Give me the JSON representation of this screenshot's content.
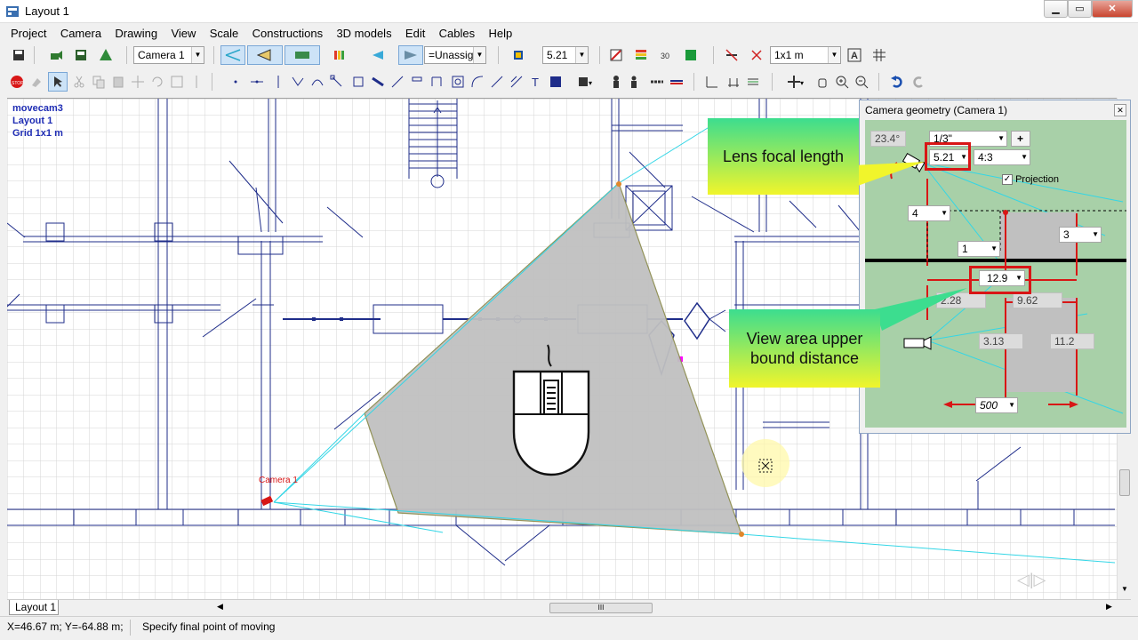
{
  "window": {
    "title": "Layout 1",
    "min": "▁",
    "max": "▭",
    "close": "✕"
  },
  "menu": [
    "Project",
    "Camera",
    "Drawing",
    "View",
    "Scale",
    "Constructions",
    "3D models",
    "Edit",
    "Cables",
    "Help"
  ],
  "toolbar1": {
    "camera_select": "Camera 1",
    "group_select": "=Unassigne",
    "focal_select": "5.21",
    "grid_select": "1x1 m"
  },
  "plan": {
    "info": [
      "movecam3",
      "Layout 1",
      "Grid 1x1 m"
    ],
    "camera_label": "Camera 1"
  },
  "camera_panel": {
    "title": "Camera geometry (Camera 1)",
    "close": "✕",
    "angle": "23.4°",
    "sensor": "1/3\"",
    "plus": "+",
    "focal": "5.21",
    "aspect": "4:3",
    "projection_label": "Projection",
    "projection_checked": true,
    "height": "4",
    "lower_dist": "1",
    "upper_height": "3",
    "upper_distance": "12.9",
    "width_left": "2.28",
    "width_right": "9.62",
    "dist_a": "3.13",
    "dist_b": "11.2",
    "resolution": "500"
  },
  "callouts": {
    "lens": "Lens focal length",
    "view": "View area upper bound distance"
  },
  "tabs": {
    "layout_tab": "Layout 1",
    "hscroll_grip": "III"
  },
  "status": {
    "coords": "X=46.67 m; Y=-64.88 m;",
    "message": "Specify final point of moving"
  },
  "colors": {
    "plan_lines": "#1f2d8a",
    "view_area": "#c0c0c0",
    "fov_lines": "#33d6e6",
    "camera_red": "#d81616",
    "panel_bg": "#a8d0a8"
  }
}
